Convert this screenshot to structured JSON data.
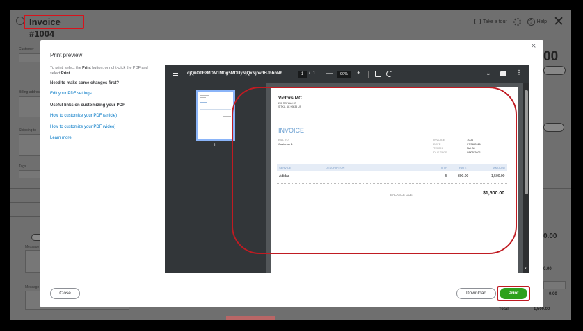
{
  "app": {
    "invoice_title": "Invoice #1004",
    "take_tour": "Take a tour",
    "help": "Help"
  },
  "background": {
    "customer_label": "Customer",
    "billing_label": "Billing address",
    "shipping_label": "Shipping to",
    "tags_label": "Tags",
    "message_label": "Message",
    "memo_label": "Message",
    "amount_partial": "00",
    "total_label": "Total",
    "total_partial": "1,500.00",
    "side_values": [
      "0.00",
      "0.00",
      "0.00",
      "0.00"
    ]
  },
  "modal": {
    "title": "Print preview",
    "close_x": "×",
    "instructions_prefix": "To print, select the ",
    "instructions_print": "Print",
    "instructions_middle": " button, or right-click the PDF and select ",
    "instructions_print2": "Print",
    "instructions_end": ".",
    "need_changes": "Need to make some changes first?",
    "edit_pdf_settings": "Edit your PDF settings",
    "useful_links": "Useful links on customizing your PDF",
    "customize_article": "How to customize your PDF (article)",
    "customize_video": "How to customize your PDF (video)",
    "learn_more": "Learn more",
    "close_button": "Close",
    "download_button": "Download",
    "print_button": "Print"
  },
  "viewer": {
    "filename": "djQ6OTEzMDM1MDg5MDUyNjQxNjovdHJhbnNh...",
    "page_current": "1",
    "page_sep": "/",
    "page_total": "1",
    "zoom": "90%",
    "minus": "—",
    "plus": "+",
    "thumb_label": "1"
  },
  "document": {
    "company": "Victors MC",
    "address_line1": "201 RAYLAN ST",
    "address_line2": "SITKA, AK  99835 US",
    "heading": "INVOICE",
    "bill_to_label": "BILL TO",
    "bill_to_value": "Customer 1",
    "meta": [
      {
        "label": "INVOICE",
        "value": "1004"
      },
      {
        "label": "DATE",
        "value": "07/06/2021"
      },
      {
        "label": "TERMS",
        "value": "Net 30"
      },
      {
        "label": "DUE DATE",
        "value": "08/05/2021"
      }
    ],
    "columns": [
      "SERVICE",
      "DESCRIPTION",
      "QTY",
      "RATE",
      "AMOUNT"
    ],
    "rows": [
      {
        "service": "Adidas",
        "description": "",
        "qty": "5",
        "rate": "300.00",
        "amount": "1,500.00"
      }
    ],
    "balance_due_label": "BALANCE DUE",
    "balance_due_value": "$1,500.00"
  },
  "colors": {
    "highlight": "#c01b22",
    "print_green": "#2ca01c",
    "link_blue": "#0077c5"
  }
}
